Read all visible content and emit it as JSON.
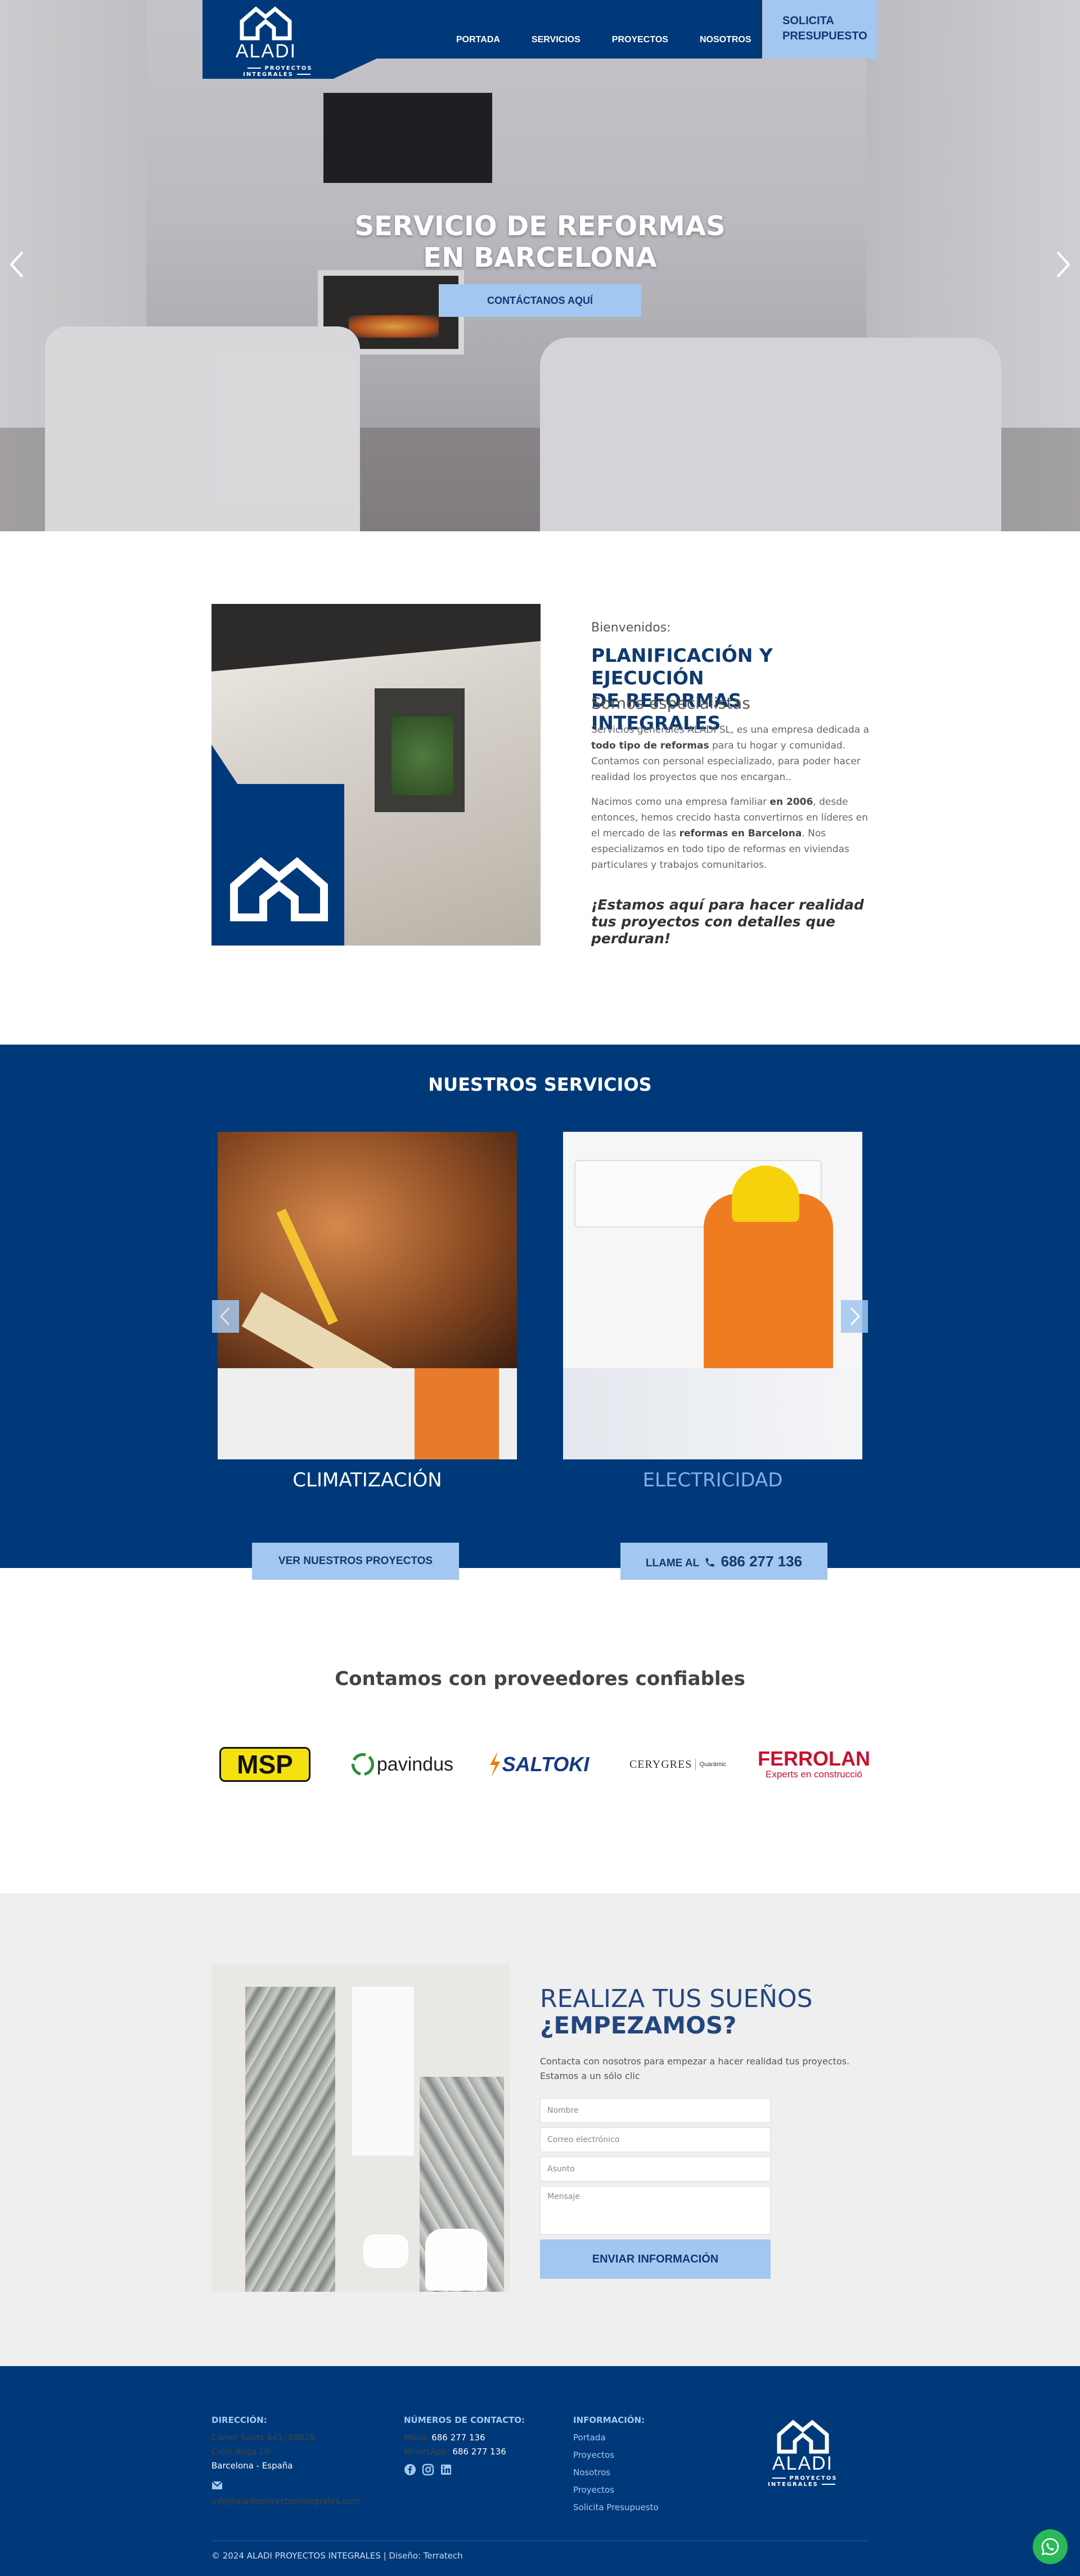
{
  "colors": {
    "primary": "#003979",
    "accent": "#a2c8f1",
    "whatsapp": "#2ab858"
  },
  "brand": {
    "name": "ALADI",
    "tagline": "PROYECTOS INTEGRALES"
  },
  "nav": {
    "items": [
      "PORTADA",
      "SERVICIOS",
      "PROYECTOS",
      "NOSOTROS"
    ],
    "cta": [
      "SOLICITA",
      "PRESUPUESTO"
    ]
  },
  "hero": {
    "title_line1": "SERVICIO DE REFORMAS",
    "title_line2": "EN BARCELONA",
    "cta": "CONTÁCTANOS AQUÍ"
  },
  "welcome": {
    "greeting": "Bienvenidos:",
    "title_line1": "PLANIFICACIÓN Y EJECUCIÓN",
    "title_line2": "DE REFORMAS INTEGRALES",
    "subtitle": "Somos especialistas",
    "p1_a": "Servicios generales ALADI SL, es una empresa dedicada a ",
    "p1_b": "todo tipo de reformas",
    "p1_c": " para tu hogar y comunidad. Contamos con personal especializado, para poder hacer realidad los proyectos que nos encargan..",
    "p2_a": "Nacimos como una empresa familiar ",
    "p2_b": "en 2006",
    "p2_c": ", desde entonces, hemos crecido hasta convertirnos en líderes en el mercado de las ",
    "p2_d": "reformas en Barcelona",
    "p2_e": ". Nos especializamos en todo tipo de reformas en viviendas particulares y trabajos comunitarios.",
    "quote": "¡Estamos aquí para hacer realidad tus proyectos con detalles que perduran!"
  },
  "services": {
    "title": "NUESTROS SERVICIOS",
    "cards": [
      "CLIMATIZACIÓN",
      "ELECTRICIDAD"
    ],
    "btn_projects": "VER NUESTROS PROYECTOS",
    "btn_call_prefix": "LLAME AL",
    "btn_call_phone": "686 277 136"
  },
  "providers": {
    "title": "Contamos con proveedores confiables",
    "logos": [
      "MSP",
      "pavindus",
      "SALTOKI",
      "CERYGRES",
      "Quarámic",
      "FERROLAN",
      "Experts en construcció"
    ]
  },
  "contact": {
    "title1": "REALIZA TUS SUEÑOS",
    "title2": "¿EMPEZAMOS?",
    "desc": "Contacta con nosotros para empezar a hacer realidad tus proyectos. Estamos a un sólo clic",
    "fields": {
      "name": "Nombre",
      "email": "Correo electrónico",
      "subject": "Asunto",
      "message": "Mensaje"
    },
    "submit": "ENVIAR INFORMACIÓN"
  },
  "footer": {
    "address_head": "DIRECCIÓN:",
    "address1": "Carrer Sants 441, 08028",
    "address2": "Calle Aliga 10",
    "address3": "Barcelona - España",
    "email": "info@aladiproyectosintegrales.com",
    "phones_head": "NÚMEROS DE CONTACTO:",
    "mobile_label": "Móvil:",
    "mobile": "686 277 136",
    "wa_label": "WhatsApp:",
    "wa": "686 277 136",
    "info_head": "INFORMACIÓN:",
    "info_links": [
      "Portada",
      "Proyectos",
      "Nosotros",
      "Proyectos",
      "Solicita Presupuesto"
    ],
    "copyright": "© 2024 ALADI PROYECTOS INTEGRALES | Diseño: Terratech"
  }
}
